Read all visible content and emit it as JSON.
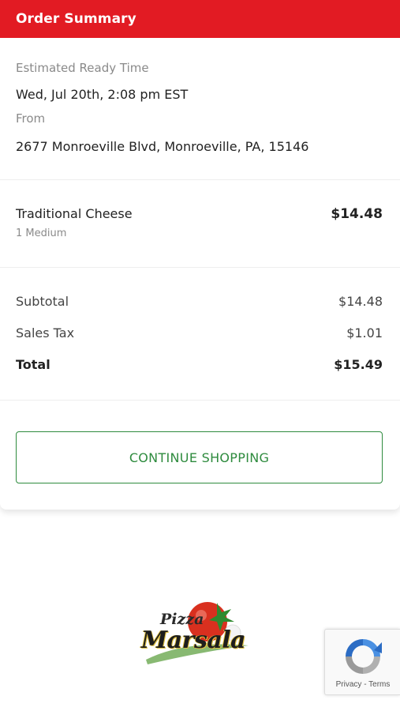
{
  "header": {
    "title": "Order Summary"
  },
  "order_info": {
    "ready_label": "Estimated Ready Time",
    "ready_value": "Wed, Jul 20th, 2:08 pm EST",
    "from_label": "From",
    "from_value": "2677 Monroeville Blvd, Monroeville, PA, 15146"
  },
  "items": [
    {
      "name": "Traditional Cheese",
      "size": "1 Medium",
      "price": "$14.48"
    }
  ],
  "totals": {
    "subtotal_label": "Subtotal",
    "subtotal_value": "$14.48",
    "tax_label": "Sales Tax",
    "tax_value": "$1.01",
    "total_label": "Total",
    "total_value": "$15.49"
  },
  "actions": {
    "continue_label": "CONTINUE SHOPPING"
  },
  "footer": {
    "logo_text_line1": "Pizza",
    "logo_text_line2": "Marsala",
    "recaptcha_links": "Privacy - Terms"
  },
  "colors": {
    "header_bg": "#e21b23",
    "accent_green": "#2e8b3e",
    "muted_text": "#8a8a8a"
  },
  "icons": [
    "recaptcha-icon",
    "logo-tomato-icon"
  ]
}
